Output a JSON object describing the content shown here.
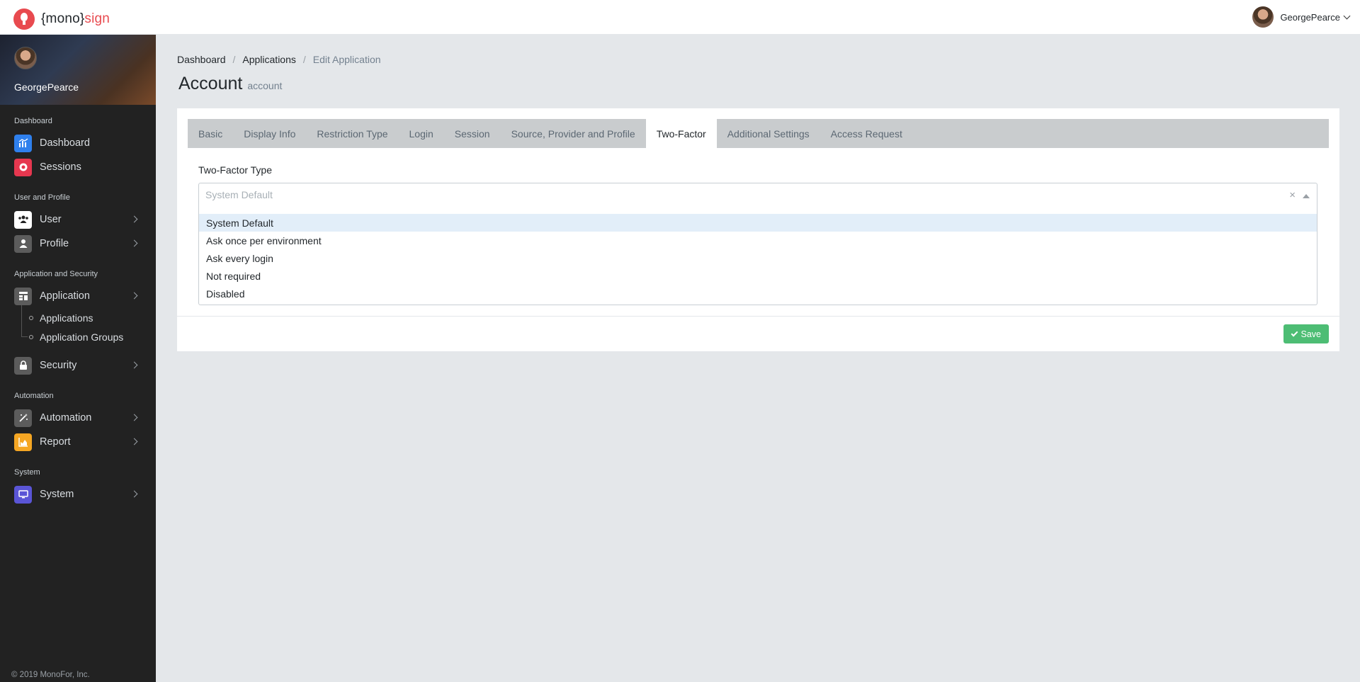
{
  "header": {
    "logo_prefix": "{mono}",
    "logo_suffix": "sign",
    "user_name": "GeorgePearce"
  },
  "sidebar": {
    "profile_name": "GeorgePearce",
    "sections": [
      {
        "title": "Dashboard",
        "items": [
          {
            "label": "Dashboard",
            "icon": "chart-icon",
            "color": "#2f80ed"
          },
          {
            "label": "Sessions",
            "icon": "record-icon",
            "color": "#e6374f"
          }
        ]
      },
      {
        "title": "User and Profile",
        "items": [
          {
            "label": "User",
            "icon": "users-icon",
            "color": "#ffffff"
          },
          {
            "label": "Profile",
            "icon": "person-icon",
            "color": "#5c5c5c"
          }
        ]
      },
      {
        "title": "Application and Security",
        "items": [
          {
            "label": "Application",
            "icon": "app-icon",
            "color": "#5c5c5c"
          },
          {
            "label": "Security",
            "icon": "lock-icon",
            "color": "#5c5c5c"
          }
        ]
      },
      {
        "title": "Automation",
        "items": [
          {
            "label": "Automation",
            "icon": "wand-icon",
            "color": "#5c5c5c"
          },
          {
            "label": "Report",
            "icon": "area-chart-icon",
            "color": "#f5a623"
          }
        ]
      },
      {
        "title": "System",
        "items": [
          {
            "label": "System",
            "icon": "monitor-icon",
            "color": "#5a55d6"
          }
        ]
      }
    ],
    "application_sub": [
      "Applications",
      "Application Groups"
    ],
    "footer": "© 2019 MonoFor, Inc."
  },
  "breadcrumb": [
    "Dashboard",
    "Applications",
    "Edit Application"
  ],
  "page": {
    "title": "Account",
    "subtitle": "account"
  },
  "tabs": [
    {
      "label": "Basic"
    },
    {
      "label": "Display Info"
    },
    {
      "label": "Restriction Type"
    },
    {
      "label": "Login"
    },
    {
      "label": "Session"
    },
    {
      "label": "Source, Provider and Profile"
    },
    {
      "label": "Two-Factor",
      "active": true
    },
    {
      "label": "Additional Settings"
    },
    {
      "label": "Access Request"
    }
  ],
  "form": {
    "label": "Two-Factor Type",
    "placeholder": "System Default",
    "clear": "×",
    "options": [
      "System Default",
      "Ask once per environment",
      "Ask every login",
      "Not required",
      "Disabled"
    ],
    "highlighted": "System Default"
  },
  "save_label": "Save",
  "colors": {
    "accent": "#e84a4f",
    "save": "#4dbd74",
    "sidebar": "#222222"
  }
}
